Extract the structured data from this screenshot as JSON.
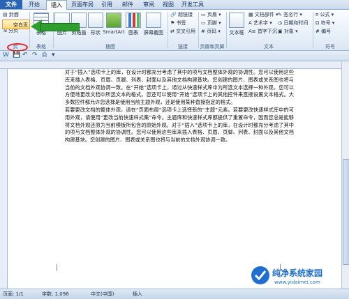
{
  "tabs": [
    "文件",
    "开始",
    "插入",
    "页面布局",
    "引用",
    "邮件",
    "审阅",
    "视图",
    "开发工具"
  ],
  "ribbon": {
    "pages_group": {
      "cover": "封面",
      "blank": "空白页",
      "page_break": "分页",
      "label": "页"
    },
    "tables_group": {
      "table": "表格",
      "label": "表格"
    },
    "illustrations_group": {
      "picture": "图片",
      "clipart": "剪贴画",
      "shapes": "形状",
      "smartart": "SmartArt",
      "chart": "图表",
      "screenshot": "屏幕截图",
      "label": "插图"
    },
    "links_group": {
      "hyperlink": "超链接",
      "bookmark": "书签",
      "crossref": "交叉引用",
      "label": "链接"
    },
    "header_footer_group": {
      "header": "页眉",
      "footer": "页脚",
      "page_number": "页码",
      "label": "页眉和页脚"
    },
    "text_group": {
      "textbox": "文本框",
      "quickparts": "文档部件",
      "wordart": "艺术字",
      "dropcap": "首字下沉",
      "signature": "签名行",
      "datetime": "日期和时间",
      "object": "对象",
      "label": "文本"
    },
    "symbols_group": {
      "equation": "公式",
      "symbol": "符号",
      "number": "编号",
      "label": "符号"
    }
  },
  "document": {
    "paragraphs": [
      "对于“插入”选项卡上的库，在设计时都充分考虑了其中的项与文档整体外观的协调性。您可以使用这些库来插入表格、页眉、页脚、列表、封面以及其他文档构建基块。您创建的图片、图表或关系图也将与当前的文档外观协调一致。在“开始”选项卡上，通过从快速样式库中为所选文本选择一种外观，您可以方便地更改文档中所选文本的格式。您还可以使用“开始”选项卡上的其他控件来直接设置文本格式。大多数控件都允许您选择是使用当前主题外观，还是使用某种直接指定的格式。",
      "若要更改文档的整体外观，请在“页面布局”选项卡上选择新的“主题”元素。若要更改快速样式库中的可用外观，请使用“更改当前快速样式集”命令。主题库和快速样式库都提供了重置命令，因而您总是能够将文档外观还原为当前模板所包含的原始外观。对于“插入”选项卡上的库，在设计时都充分考虑了其中的项与文档整体外观的协调性。您可以使用这些库来插入表格、页眉、页脚、列表、封面以及其他文档构建基块。您创建的图片、图表或关系图也将与当前的文档外观协调一致。"
    ]
  },
  "status": {
    "page": "页面: 1/1",
    "words": "字数: 1,096",
    "lang": "中文(中国)",
    "mode": "插入"
  },
  "watermark": {
    "title": "纯净系统家园",
    "url": "www.yidaimei.com"
  },
  "colors": {
    "accent": "#2a64b7",
    "arrow": "#2e9e2e",
    "oval": "#e02020"
  }
}
